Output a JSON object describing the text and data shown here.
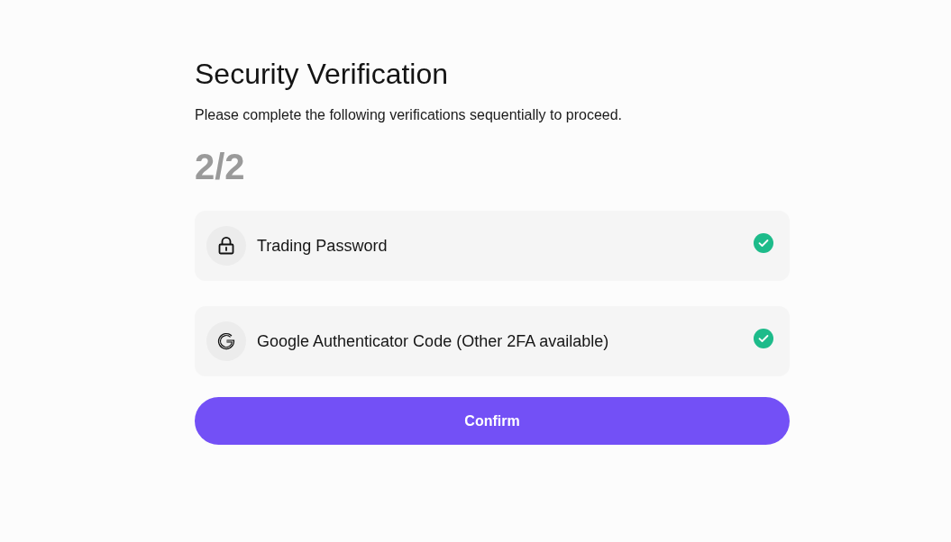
{
  "title": "Security Verification",
  "subtitle": "Please complete the following verifications sequentially to proceed.",
  "progress": "2/2",
  "verifications": [
    {
      "kind": "password",
      "label": "Trading Password",
      "verified": true
    },
    {
      "kind": "authenticator",
      "label": "Google Authenticator Code (Other 2FA available)",
      "verified": true
    }
  ],
  "confirm_button": "Confirm"
}
